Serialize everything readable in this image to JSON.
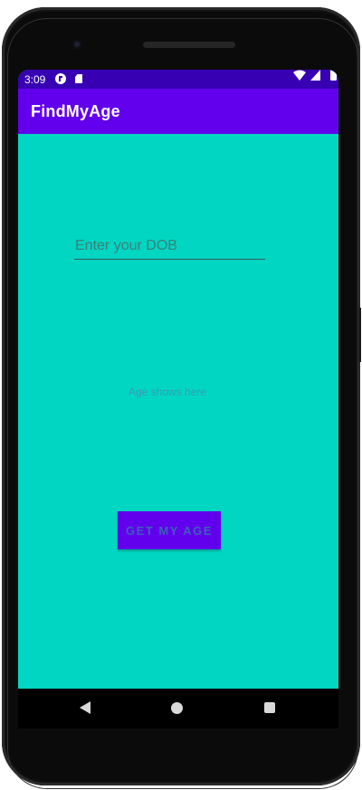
{
  "status_bar": {
    "time": "3:09",
    "icons": [
      "app-notification-icon",
      "sd-card-icon",
      "wifi-icon",
      "signal-icon",
      "battery-icon"
    ]
  },
  "app_bar": {
    "title": "FindMyAge"
  },
  "form": {
    "dob_placeholder": "Enter your DOB",
    "dob_value": ""
  },
  "result": {
    "age_text": "Age shows here"
  },
  "actions": {
    "get_age_label": "GET MY AGE"
  },
  "nav_bar": {
    "icons": [
      "back-icon",
      "home-icon",
      "recents-icon"
    ]
  },
  "colors": {
    "status_bar": "#3700b3",
    "primary": "#6200ee",
    "background": "#00d6c2"
  }
}
